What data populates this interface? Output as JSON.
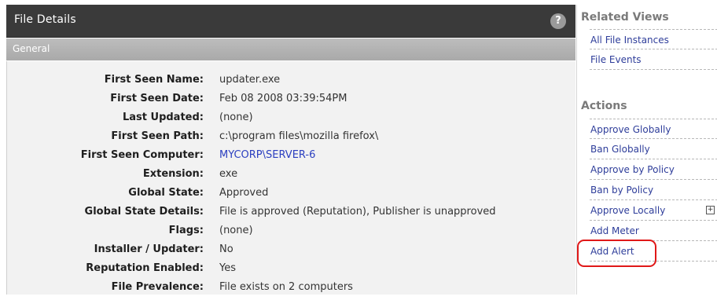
{
  "panel": {
    "title": "File Details",
    "help_glyph": "?",
    "section": "General",
    "fields": [
      {
        "label": "First Seen Name:",
        "value": "updater.exe"
      },
      {
        "label": "First Seen Date:",
        "value": "Feb 08 2008 03:39:54PM"
      },
      {
        "label": "Last Updated:",
        "value": "(none)"
      },
      {
        "label": "First Seen Path:",
        "value": "c:\\program files\\mozilla firefox\\"
      },
      {
        "label": "First Seen Computer:",
        "value": "MYCORP\\SERVER-6"
      },
      {
        "label": "Extension:",
        "value": "exe"
      },
      {
        "label": "Global State:",
        "value": "Approved"
      },
      {
        "label": "Global State Details:",
        "value": "File is approved (Reputation), Publisher is unapproved"
      },
      {
        "label": "Flags:",
        "value": "(none)"
      },
      {
        "label": "Installer / Updater:",
        "value": "No"
      },
      {
        "label": "Reputation Enabled:",
        "value": "Yes"
      },
      {
        "label": "File Prevalence:",
        "value": "File exists on 2 computers"
      }
    ]
  },
  "sidebar": {
    "related_heading": "Related Views",
    "related_items": [
      "All File Instances",
      "File Events"
    ],
    "actions_heading": "Actions",
    "action_items": [
      "Approve Globally",
      "Ban Globally",
      "Approve by Policy",
      "Ban by Policy",
      "Approve Locally",
      "Add Meter",
      "Add Alert"
    ],
    "expand_glyph": "+"
  },
  "icons": {
    "help": "help-icon",
    "expand": "plus-icon"
  },
  "colors": {
    "titlebar": "#3a3a3a",
    "link": "#2b3fc0",
    "highlight": "#e01818"
  }
}
